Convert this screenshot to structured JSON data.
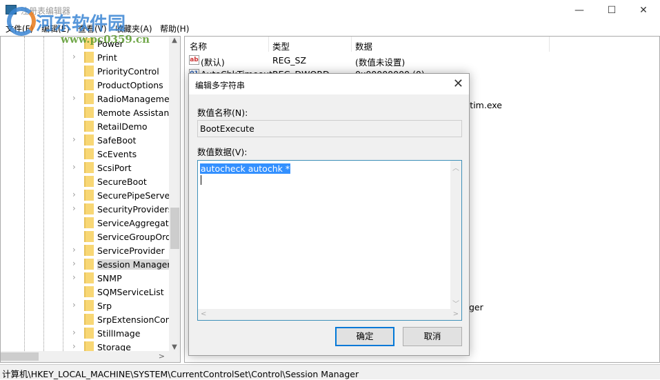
{
  "window": {
    "title": "注册表编辑器",
    "minimize": "—",
    "maximize": "☐",
    "close": "✕"
  },
  "menu": [
    "文件(F)",
    "编辑(E)",
    "查看(V)",
    "收藏夹(A)",
    "帮助(H)"
  ],
  "watermark": {
    "name": "河东软件园",
    "url": "www.pc0359.cn"
  },
  "tree": {
    "items": [
      {
        "label": "Power",
        "expandable": false
      },
      {
        "label": "Print",
        "expandable": true
      },
      {
        "label": "PriorityControl",
        "expandable": false
      },
      {
        "label": "ProductOptions",
        "expandable": false
      },
      {
        "label": "RadioManagement",
        "expandable": true
      },
      {
        "label": "Remote Assistance",
        "expandable": false
      },
      {
        "label": "RetailDemo",
        "expandable": false
      },
      {
        "label": "SafeBoot",
        "expandable": true
      },
      {
        "label": "ScEvents",
        "expandable": false
      },
      {
        "label": "ScsiPort",
        "expandable": true
      },
      {
        "label": "SecureBoot",
        "expandable": false
      },
      {
        "label": "SecurePipeServers",
        "expandable": true
      },
      {
        "label": "SecurityProviders",
        "expandable": true
      },
      {
        "label": "ServiceAggregatedEvents",
        "expandable": false
      },
      {
        "label": "ServiceGroupOrder",
        "expandable": false
      },
      {
        "label": "ServiceProvider",
        "expandable": true
      },
      {
        "label": "Session Manager",
        "expandable": true,
        "selected": true
      },
      {
        "label": "SNMP",
        "expandable": true
      },
      {
        "label": "SQMServiceList",
        "expandable": false
      },
      {
        "label": "Srp",
        "expandable": true
      },
      {
        "label": "SrpExtensionConfig",
        "expandable": false
      },
      {
        "label": "StillImage",
        "expandable": true
      },
      {
        "label": "Storage",
        "expandable": true
      }
    ]
  },
  "list": {
    "columns": [
      "名称",
      "类型",
      "数据"
    ],
    "rows": [
      {
        "name": "(默认)",
        "type": "REG_SZ",
        "data": "(数值未设置)"
      },
      {
        "name": "AutoChkTimeout",
        "type": "REG_DWORD",
        "data": "0x00000000 (0)"
      }
    ],
    "fragments": [
      "ootim.exe",
      "ger"
    ]
  },
  "dialog": {
    "title": "编辑多字符串",
    "name_label": "数值名称(N):",
    "name_value": "BootExecute",
    "data_label": "数值数据(V):",
    "data_value": "autocheck autochk *",
    "ok": "确定",
    "cancel": "取消"
  },
  "status": {
    "path": "计算机\\HKEY_LOCAL_MACHINE\\SYSTEM\\CurrentControlSet\\Control\\Session Manager"
  }
}
